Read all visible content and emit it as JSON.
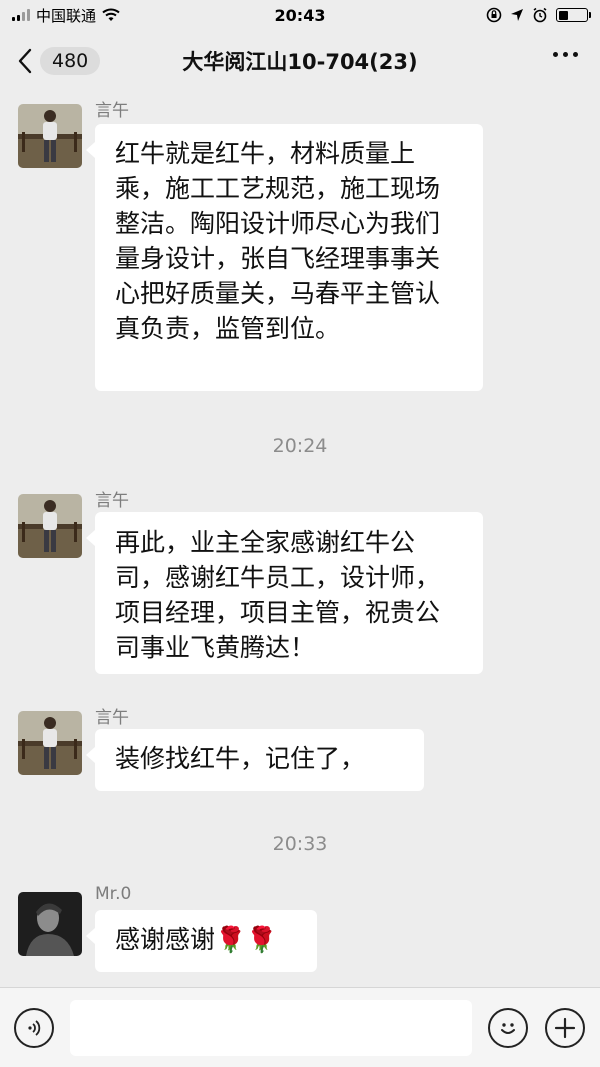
{
  "status_bar": {
    "carrier": "中国联通",
    "time": "20:43"
  },
  "nav": {
    "unread_count": "480",
    "title": "大华阅江山10-704(23)"
  },
  "messages": [
    {
      "sender": "言午",
      "text": "红牛就是红牛，材料质量上乘，施工工艺规范，施工现场整洁。陶阳设计师尽心为我们量身设计，张自飞经理事事关心把好质量关，马春平主管认真负责，监管到位。"
    },
    {
      "timestamp": "20:24"
    },
    {
      "sender": "言午",
      "text": "再此，业主全家感谢红牛公司，感谢红牛员工，设计师，项目经理，项目主管，祝贵公司事业飞黄腾达！"
    },
    {
      "sender": "言午",
      "text": "装修找红牛，记住了，"
    },
    {
      "timestamp": "20:33"
    },
    {
      "sender": "Mr.0",
      "text": "感谢感谢🌹🌹"
    }
  ],
  "input": {
    "placeholder": ""
  },
  "colors": {
    "background": "#ededed",
    "bubble": "#ffffff",
    "muted_text": "#8c8c8c"
  },
  "icons": [
    "signal-icon",
    "wifi-icon",
    "orientation-lock-icon",
    "location-icon",
    "alarm-icon",
    "battery-icon",
    "back-chevron-icon",
    "more-icon",
    "voice-icon",
    "emoji-icon",
    "plus-icon"
  ]
}
